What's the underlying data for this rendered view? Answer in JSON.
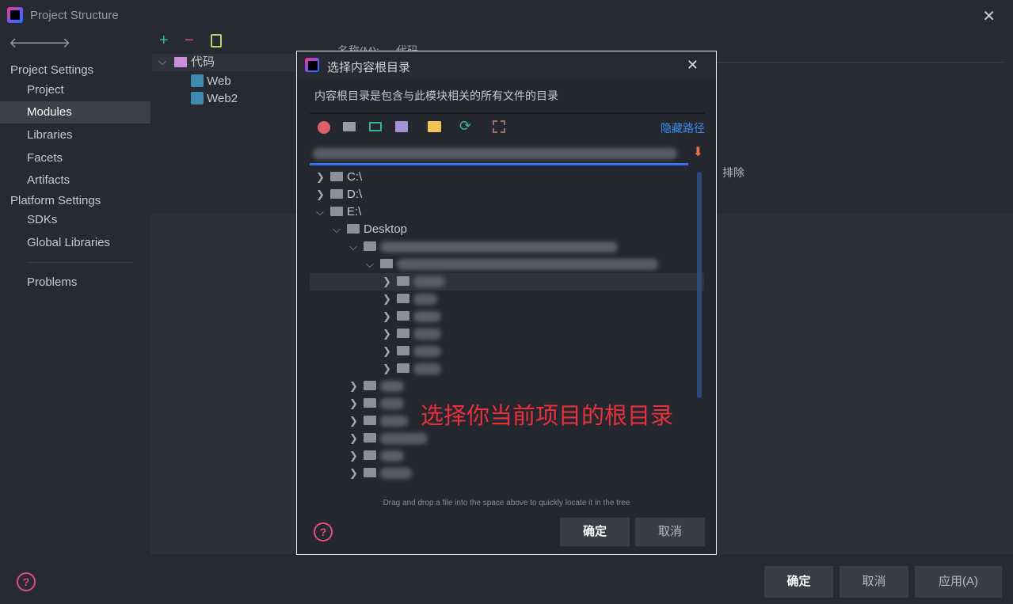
{
  "window": {
    "title": "Project Structure"
  },
  "sidebar": {
    "project_settings": "Project Settings",
    "items": [
      {
        "label": "Project"
      },
      {
        "label": "Modules"
      },
      {
        "label": "Libraries"
      },
      {
        "label": "Facets"
      },
      {
        "label": "Artifacts"
      }
    ],
    "platform_settings": "Platform Settings",
    "platform_items": [
      {
        "label": "SDKs"
      },
      {
        "label": "Global Libraries"
      }
    ],
    "problems": "Problems"
  },
  "modules_tree": {
    "root": "代码",
    "children": [
      "Web",
      "Web2"
    ]
  },
  "main": {
    "name_label": "名称(M):",
    "name_value": "代码",
    "exclude_label": "排除"
  },
  "footer": {
    "ok": "确定",
    "cancel": "取消",
    "apply": "应用(A)"
  },
  "dialog": {
    "title": "选择内容根目录",
    "description": "内容根目录是包含与此模块相关的所有文件的目录",
    "hide_path": "隐藏路径",
    "drives": [
      "C:\\",
      "D:\\",
      "E:\\"
    ],
    "desktop": "Desktop",
    "drag_hint": "Drag and drop a file into the space above to quickly locate it in the tree",
    "ok": "确定",
    "cancel": "取消",
    "toolbar_icons": [
      "home-icon",
      "desktop-icon",
      "laptop-icon",
      "module-folder-icon",
      "new-folder-icon",
      "refresh-icon",
      "select-area-icon"
    ]
  },
  "annotation": "选择你当前项目的根目录",
  "colors": {
    "accent": "#3574f0",
    "annotation": "#e8313a",
    "add": "#2fb8ae",
    "remove": "#e0507a"
  }
}
